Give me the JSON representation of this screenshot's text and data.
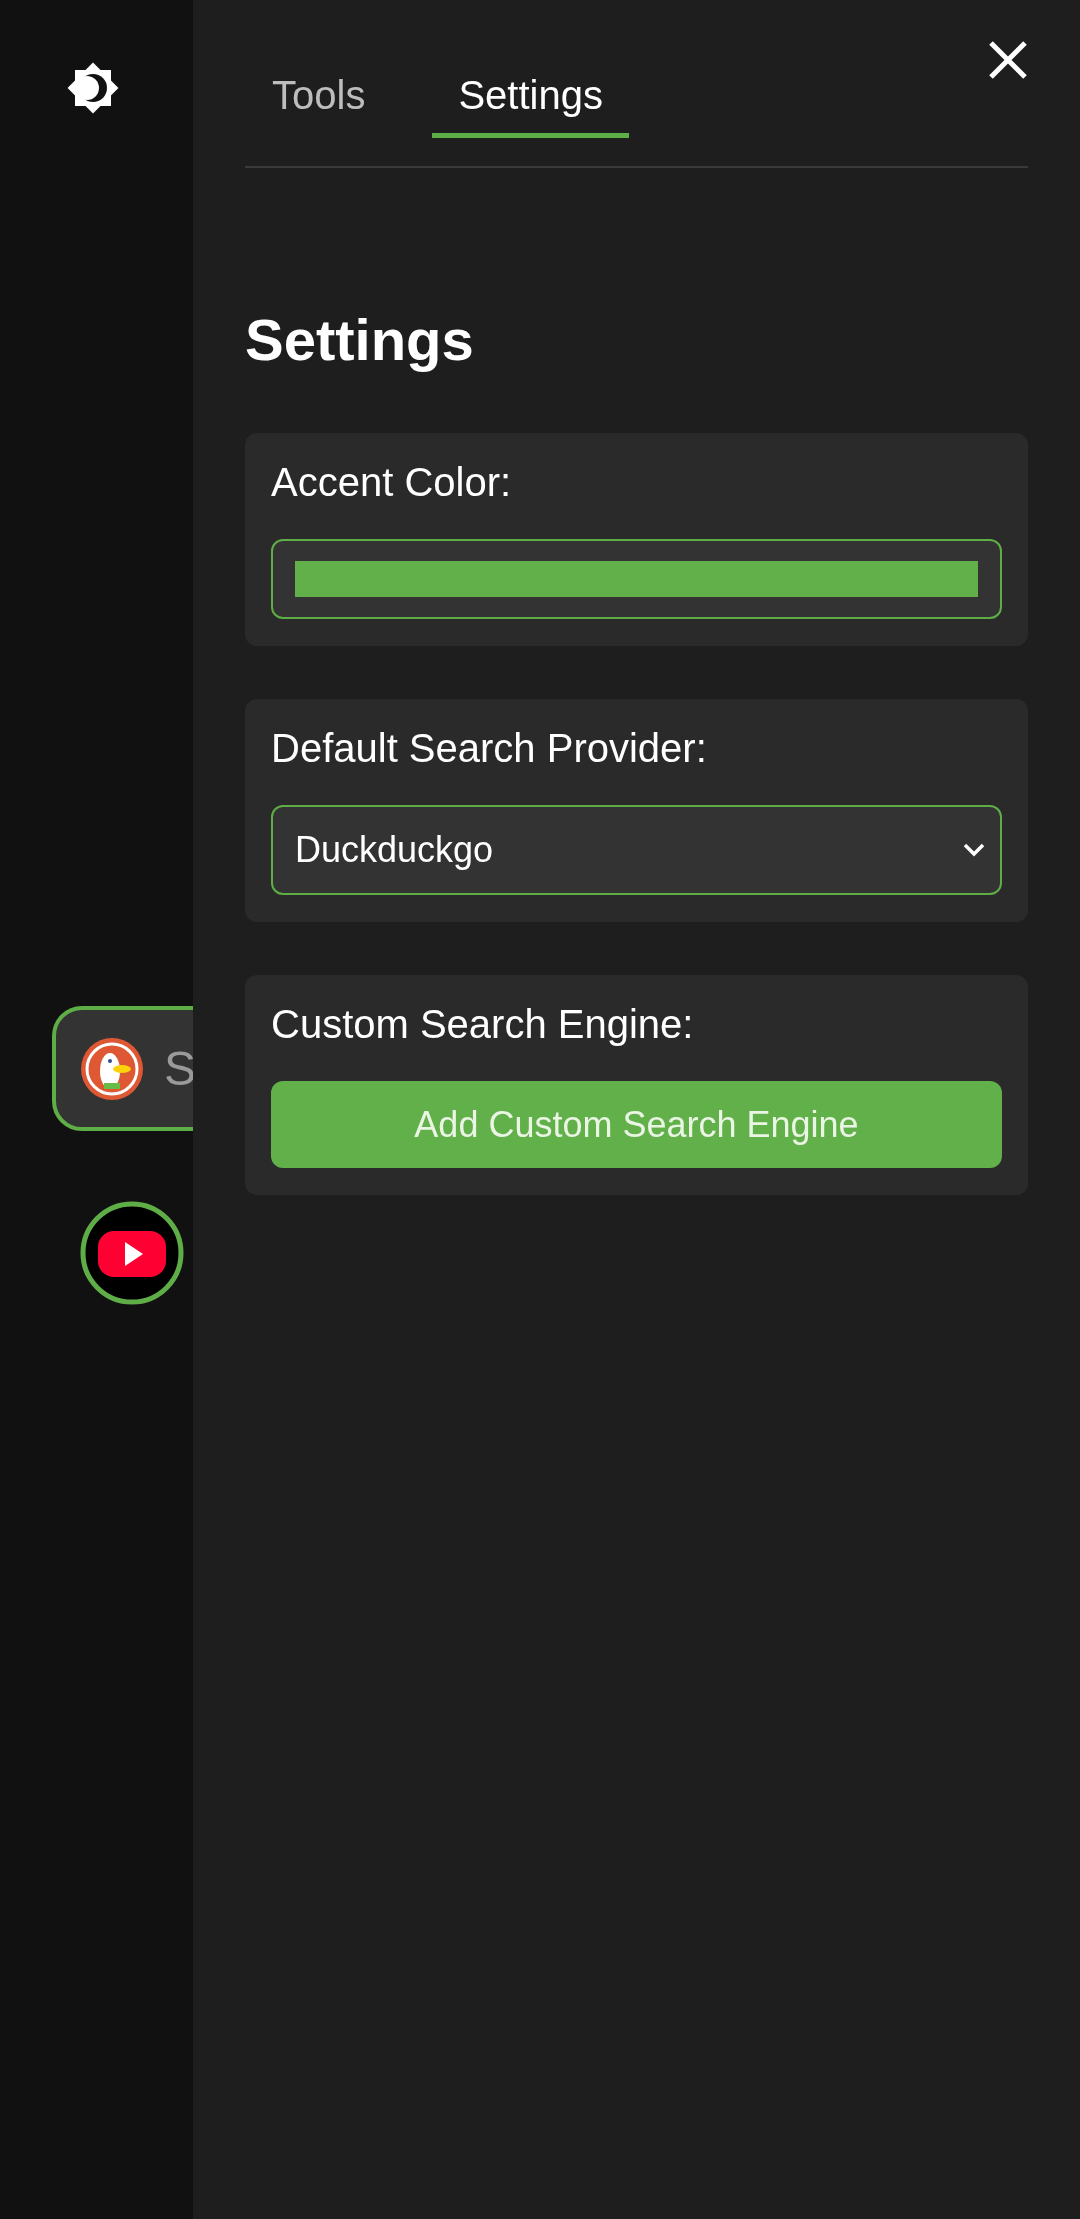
{
  "sidebar": {
    "search": {
      "placeholder": "S"
    }
  },
  "tabs": [
    {
      "label": "Tools",
      "selected": false
    },
    {
      "label": "Settings",
      "selected": true
    }
  ],
  "heading": "Settings",
  "accent": {
    "label": "Accent Color:",
    "color": "#62b04a"
  },
  "provider": {
    "label": "Default Search Provider:",
    "value": "Duckduckgo"
  },
  "custom_engine": {
    "label": "Custom Search Engine:",
    "button": "Add Custom Search Engine"
  }
}
